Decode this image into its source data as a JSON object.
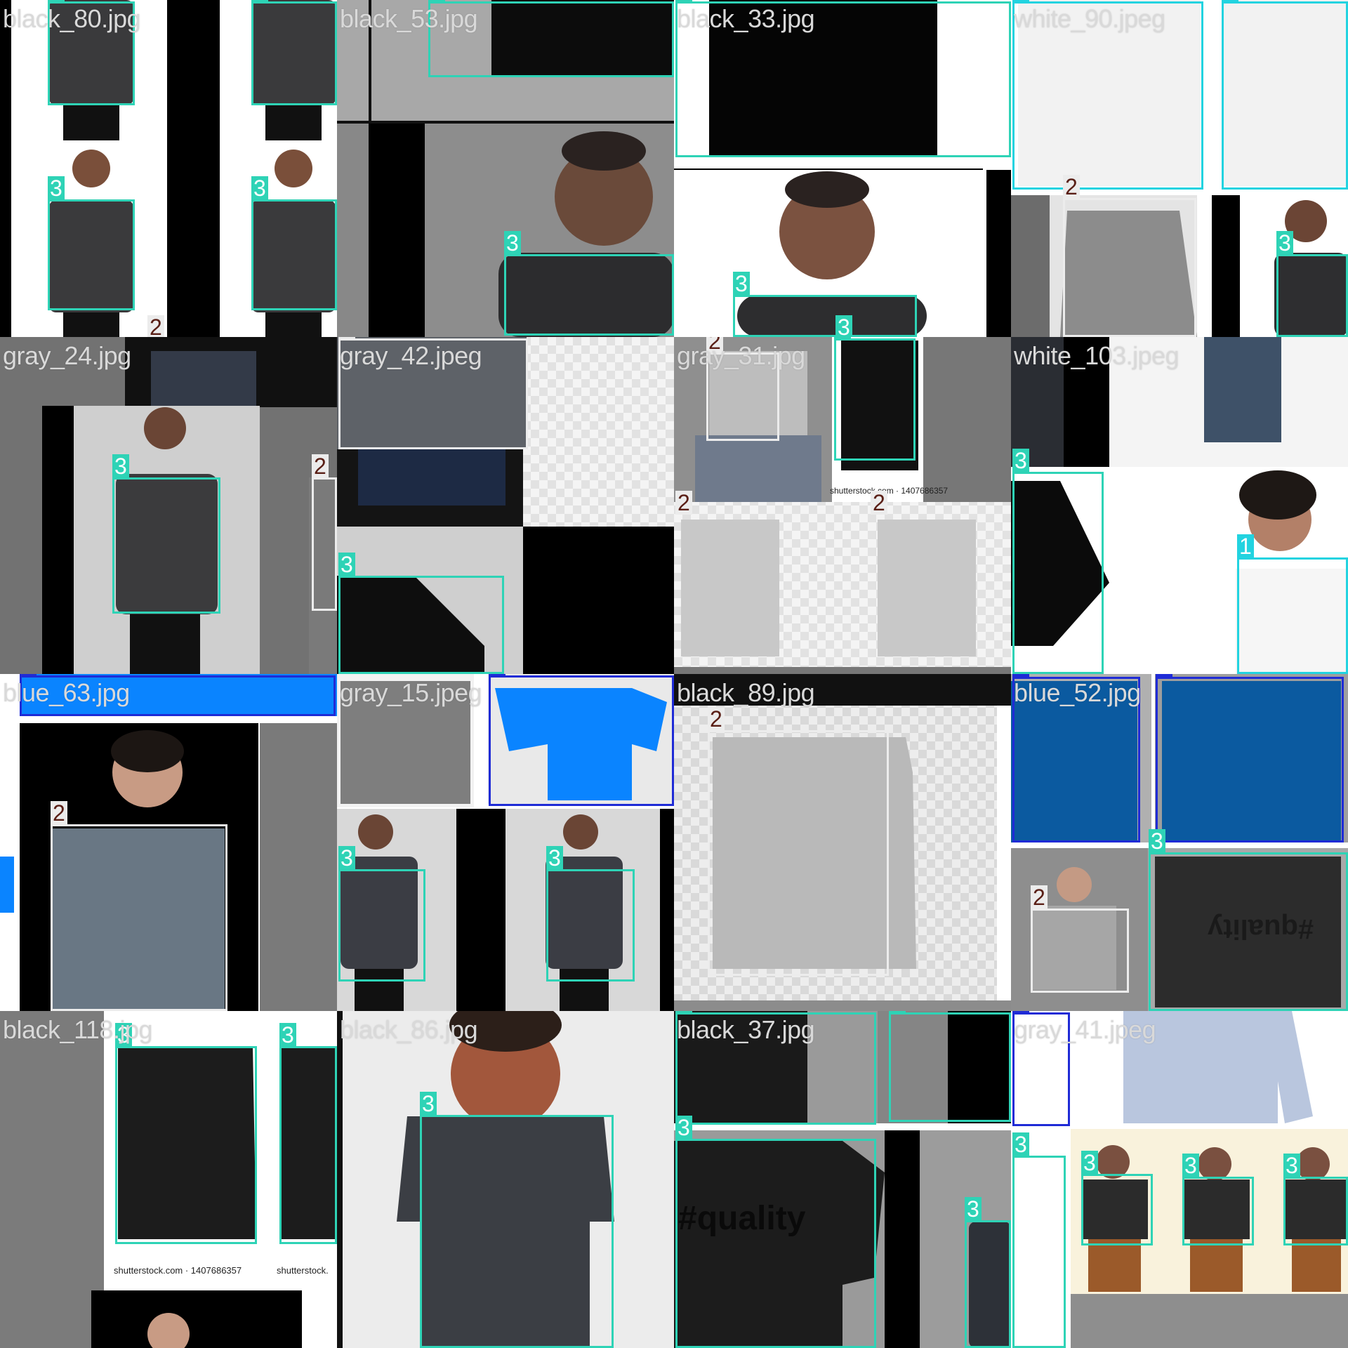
{
  "mosaic": {
    "tiles": [
      {
        "filename": "black_80.jpg"
      },
      {
        "filename": "black_53.jpg"
      },
      {
        "filename": "black_33.jpg"
      },
      {
        "filename": "white_90.jpeg"
      },
      {
        "filename": "gray_24.jpg"
      },
      {
        "filename": "gray_42.jpeg"
      },
      {
        "filename": "gray_31.jpg"
      },
      {
        "filename": "white_103.jpeg"
      },
      {
        "filename": "blue_63.jpg"
      },
      {
        "filename": "gray_15.jpeg"
      },
      {
        "filename": "black_89.jpg"
      },
      {
        "filename": "blue_52.jpg"
      },
      {
        "filename": "black_118.jpg"
      },
      {
        "filename": "black_86.jpg"
      },
      {
        "filename": "black_37.jpg"
      },
      {
        "filename": "gray_41.jpeg"
      }
    ],
    "class_ids": [
      "0",
      "1",
      "2",
      "3"
    ],
    "class_colors": {
      "0": "#1f2bd6",
      "1": "#22d3e0",
      "2": "#ececec",
      "3": "#2ed3b6"
    },
    "watermarks": [
      "shutterstock.com · 1407686357",
      "shutterstock."
    ],
    "shirt_print": "#quality"
  }
}
